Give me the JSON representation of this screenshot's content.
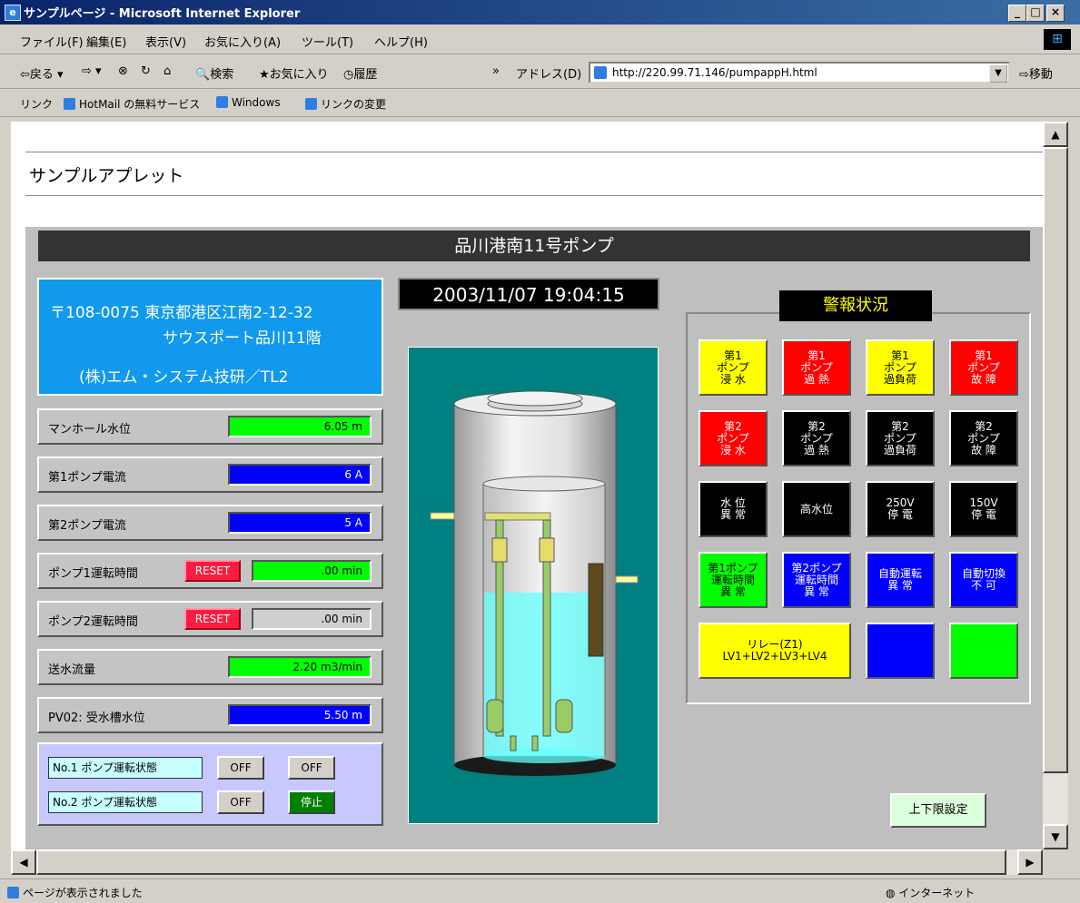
{
  "window": {
    "title": "サンプルページ - Microsoft Internet Explorer",
    "controls": [
      "_",
      "□",
      "×"
    ]
  },
  "menu": [
    "ファイル(F)",
    "編集(E)",
    "表示(V)",
    "お気に入り(A)",
    "ツール(T)",
    "ヘルプ(H)"
  ],
  "toolbar": {
    "back": "⇦戻る",
    "forward": "⇨",
    "search": "検索",
    "favorites": "お気に入り",
    "history": "履歴",
    "address_label": "アドレス(D)",
    "address_value": "http://220.99.71.146/pumpappH.html",
    "go": "移動"
  },
  "links": {
    "label": "リンク",
    "items": [
      "HotMail の無料サービス",
      "Windows",
      "リンクの変更"
    ]
  },
  "page": {
    "title": "サンプルアプレット"
  },
  "applet": {
    "header": "品川港南11号ポンプ",
    "address": {
      "line1": "〒108-0075  東京都港区江南2-12-32",
      "line2": "サウスポート品川11階",
      "line3": "(株)エム・システム技研／TL2"
    },
    "datetime": "2003/11/07 19:04:15",
    "rows": [
      {
        "label": "マンホール水位",
        "value": "6.05 m"
      },
      {
        "label": "第1ポンプ電流",
        "value": "6 A"
      },
      {
        "label": "第2ポンプ電流",
        "value": "5 A"
      },
      {
        "label": "ポンプ1運転時間",
        "reset": "RESET",
        "value": ".00 min"
      },
      {
        "label": "ポンプ2運転時間",
        "reset": "RESET",
        "value": ".00 min"
      },
      {
        "label": "送水流量",
        "value": "2.20 m3/min"
      },
      {
        "label": "PV02: 受水槽水位",
        "value": "5.50 m"
      }
    ],
    "pump_status": [
      {
        "label": "No.1 ポンプ運転状態",
        "btn1": "OFF",
        "btn2": "OFF"
      },
      {
        "label": "No.2 ポンプ運転状態",
        "btn1": "OFF",
        "btn2": "停止"
      }
    ],
    "alarm_title": "警報状況",
    "alarms": [
      {
        "text": "第1\nポンプ\n浸 水",
        "color": "yellow"
      },
      {
        "text": "第1\nポンプ\n過 熱",
        "color": "red"
      },
      {
        "text": "第1\nポンプ\n過負荷",
        "color": "yellow"
      },
      {
        "text": "第1\nポンプ\n故 障",
        "color": "red"
      },
      {
        "text": "第2\nポンプ\n浸 水",
        "color": "red"
      },
      {
        "text": "第2\nポンプ\n過 熱",
        "color": "black"
      },
      {
        "text": "第2\nポンプ\n過負荷",
        "color": "black"
      },
      {
        "text": "第2\nポンプ\n故 障",
        "color": "black"
      },
      {
        "text": "水 位\n異 常",
        "color": "black"
      },
      {
        "text": "高水位",
        "color": "black"
      },
      {
        "text": "250V\n停 電",
        "color": "black"
      },
      {
        "text": "150V\n停 電",
        "color": "black"
      },
      {
        "text": "第1ポンプ\n運転時間\n異 常",
        "color": "green"
      },
      {
        "text": "第2ポンプ\n運転時間\n異 常",
        "color": "blue"
      },
      {
        "text": "自動運転\n異 常",
        "color": "blue"
      },
      {
        "text": "自動切換\n不 可",
        "color": "blue"
      },
      {
        "text": "リレー(Z1)\nLV1+LV2+LV3+LV4",
        "color": "yellow"
      },
      {
        "text": "",
        "color": "blue"
      },
      {
        "text": "",
        "color": "green"
      }
    ],
    "limits_button": "上下限設定"
  },
  "status": {
    "text": "ページが表示されました",
    "zone": "インターネット"
  }
}
